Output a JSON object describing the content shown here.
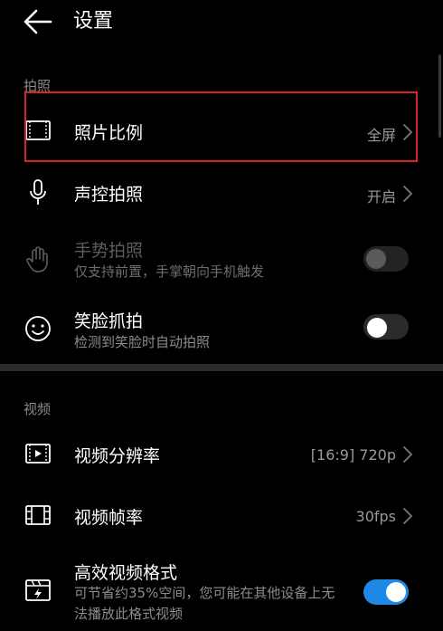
{
  "header": {
    "title": "设置",
    "back_icon": "arrow-left-icon"
  },
  "sections": {
    "photo": {
      "label": "拍照",
      "items": [
        {
          "title": "照片比例",
          "value": "全屏",
          "icon": "aspect-ratio-icon"
        },
        {
          "title": "声控拍照",
          "value": "开启",
          "icon": "microphone-icon"
        },
        {
          "title": "手势拍照",
          "subtitle": "仅支持前置，手掌朝向手机触发",
          "icon": "palm-icon",
          "enabled": false,
          "toggle": false
        },
        {
          "title": "笑脸抓拍",
          "subtitle": "检测到笑脸时自动拍照",
          "icon": "smiley-icon",
          "enabled": true,
          "toggle": false
        }
      ]
    },
    "video": {
      "label": "视频",
      "items": [
        {
          "title": "视频分辨率",
          "value": "[16:9] 720p",
          "icon": "video-resolution-icon"
        },
        {
          "title": "视频帧率",
          "value": "30fps",
          "icon": "film-strip-icon"
        },
        {
          "title": "高效视频格式",
          "subtitle": "可节省约35%空间，您可能在其他设备上无法播放此格式视频",
          "icon": "video-format-icon",
          "enabled": true,
          "toggle": true
        }
      ]
    }
  },
  "colors": {
    "background": "#000000",
    "accent": "#1e88e5",
    "highlight": "#d8232a"
  }
}
